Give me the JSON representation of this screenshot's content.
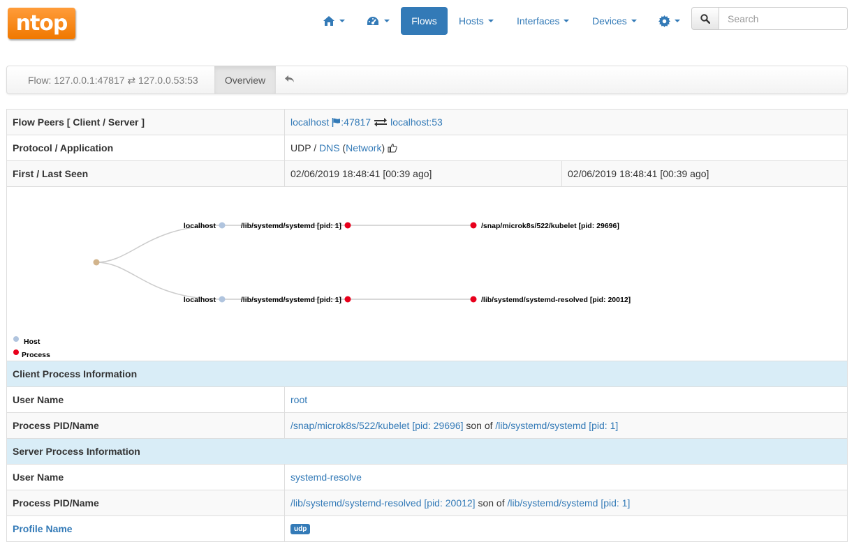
{
  "logo": {
    "text": "ntop"
  },
  "nav": {
    "flows": "Flows",
    "hosts": "Hosts",
    "interfaces": "Interfaces",
    "devices": "Devices"
  },
  "search": {
    "placeholder": "Search"
  },
  "breadcrumb": {
    "title": "Flow: 127.0.0.1:47817 ⇄ 127.0.0.53:53",
    "tab": "Overview"
  },
  "table": {
    "peers": {
      "label": "Flow Peers [ Client / Server ]",
      "client": "localhost",
      "client_port": ":47817",
      "server": "localhost",
      "server_port": ":53"
    },
    "protocol": {
      "label": "Protocol / Application",
      "l4": "UDP / ",
      "app": "DNS",
      "category": "Network"
    },
    "seen": {
      "label": "First / Last Seen",
      "first": "02/06/2019 18:48:41 [00:39 ago]",
      "last": "02/06/2019 18:48:41 [00:39 ago]"
    },
    "client_section": "Client Process Information",
    "client_user": {
      "label": "User Name",
      "value": "root"
    },
    "client_proc": {
      "label": "Process PID/Name",
      "proc": "/snap/microk8s/522/kubelet [pid: 29696]",
      "son_of": " son of ",
      "parent": "/lib/systemd/systemd [pid: 1]"
    },
    "server_section": "Server Process Information",
    "server_user": {
      "label": "User Name",
      "value": "systemd-resolve"
    },
    "server_proc": {
      "label": "Process PID/Name",
      "proc": "/lib/systemd/systemd-resolved [pid: 20012]",
      "son_of": " son of ",
      "parent": "/lib/systemd/systemd [pid: 1]"
    },
    "profile": {
      "label": "Profile Name",
      "value": "udp"
    }
  },
  "graph": {
    "branches": [
      {
        "host": "localhost",
        "parent": "/lib/systemd/systemd [pid: 1]",
        "process": "/snap/microk8s/522/kubelet [pid: 29696]"
      },
      {
        "host": "localhost",
        "parent": "/lib/systemd/systemd [pid: 1]",
        "process": "/lib/systemd/systemd-resolved [pid: 20012]"
      }
    ],
    "legend": {
      "host": "Host",
      "process": "Process"
    },
    "colors": {
      "root": "#d2b48c",
      "host": "#b0c4de",
      "process": "#e8001c",
      "link": "#cccccc"
    }
  },
  "colors": {
    "accent": "#337ab7",
    "logo": "#f07800",
    "section": "#d9edf7"
  }
}
